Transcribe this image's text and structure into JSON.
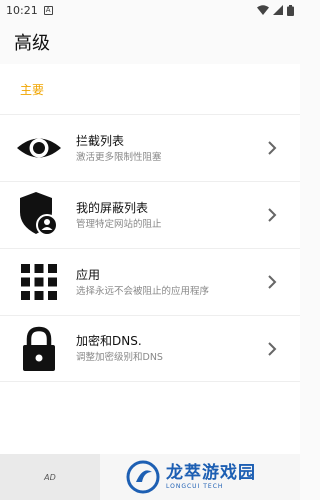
{
  "status_bar": {
    "time": "10:21",
    "notif_glyph": "A"
  },
  "app_bar": {
    "title": "高级"
  },
  "section": {
    "title": "主要"
  },
  "items": [
    {
      "icon": "eye-icon",
      "title": "拦截列表",
      "subtitle": "激活更多限制性阻塞"
    },
    {
      "icon": "shield-user-icon",
      "title": "我的屏蔽列表",
      "subtitle": "管理特定网站的阻止"
    },
    {
      "icon": "apps-grid-icon",
      "title": "应用",
      "subtitle": "选择永远不会被阻止的应用程序"
    },
    {
      "icon": "lock-icon",
      "title": "加密和DNS.",
      "subtitle": "调整加密级别和DNS"
    }
  ],
  "bottom": {
    "ad_label": "AD",
    "brand_name": "龙萃游戏园",
    "brand_sub": "LONGCUI TECH"
  },
  "colors": {
    "accent": "#f0a500",
    "brand": "#1d5fb3"
  }
}
